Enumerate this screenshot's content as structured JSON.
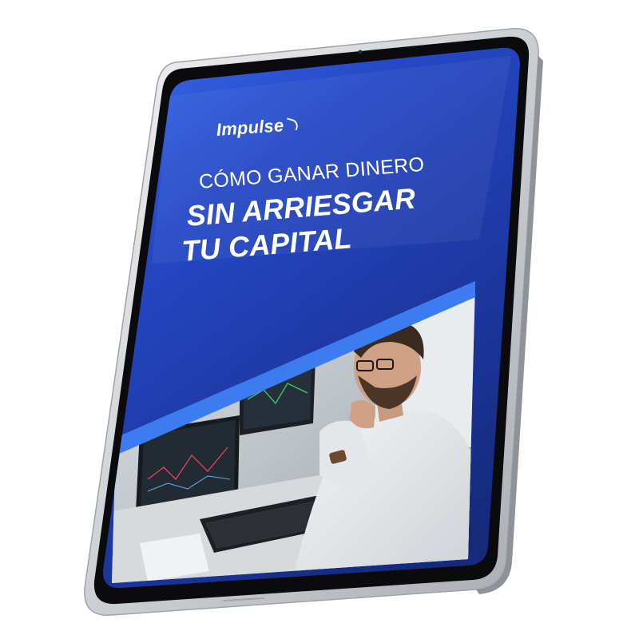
{
  "cover": {
    "brand": "Impulse",
    "title_line_1": "CÓMO GANAR DINERO",
    "title_line_2": "SIN ARRIESGAR",
    "title_line_3": "TU CAPITAL"
  },
  "colors": {
    "cover_blue_top": "#2f5fe0",
    "cover_blue_mid": "#1f3fb0",
    "cover_blue_dark": "#142a7c",
    "accent_stripe": "#3d7cf0",
    "device_frame": "#d9dbde",
    "device_bezel": "#0b0b0d"
  },
  "photo": {
    "description_icon": "man-at-trading-desk-photo"
  }
}
